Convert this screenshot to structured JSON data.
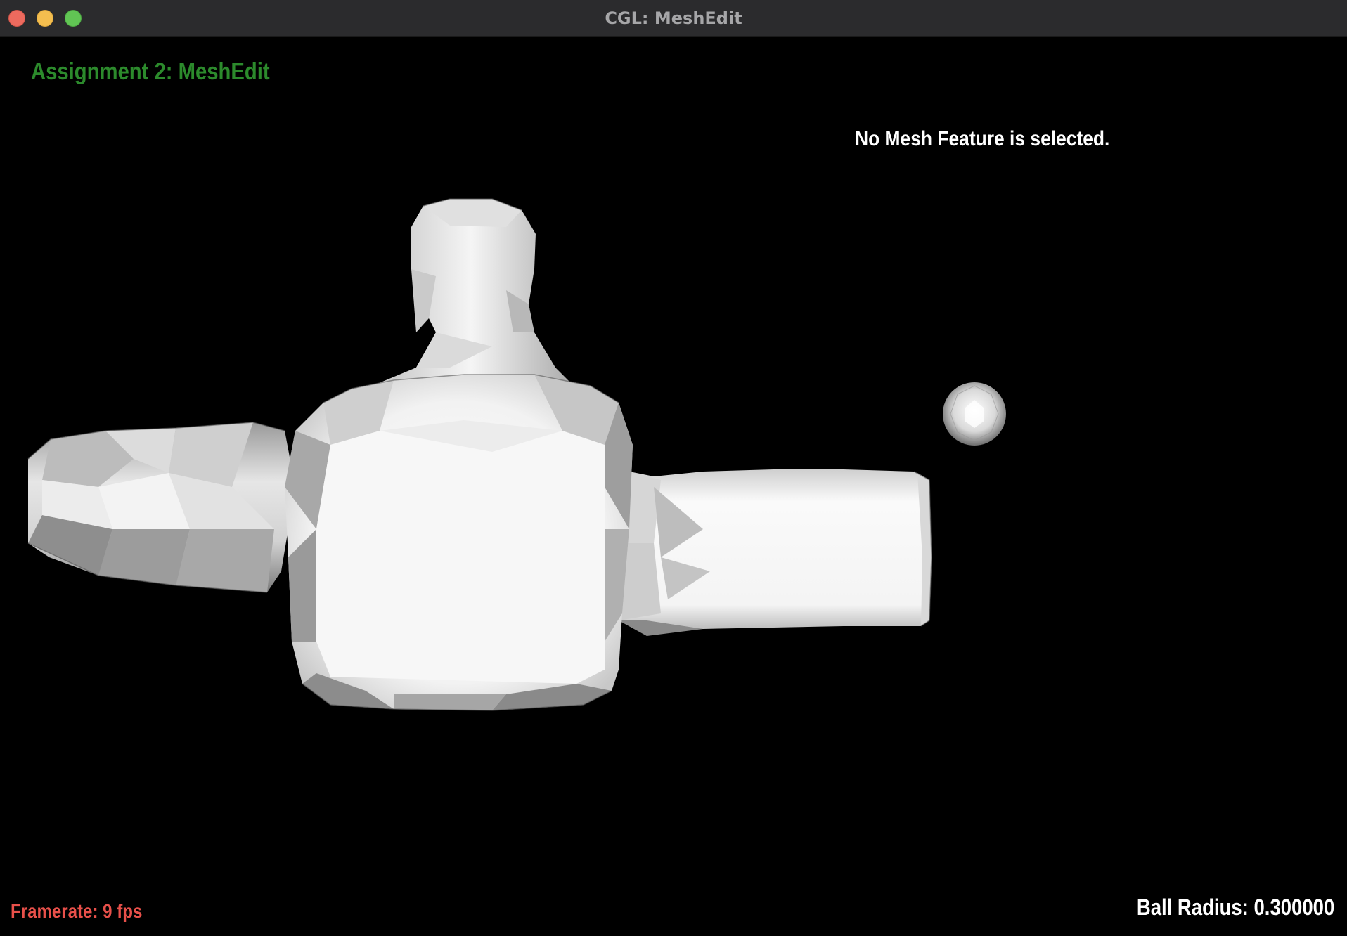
{
  "window": {
    "title": "CGL: MeshEdit"
  },
  "hud": {
    "assignment_title": "Assignment 2: MeshEdit",
    "selection_status": "No Mesh Feature is selected.",
    "framerate": "Framerate: 9 fps",
    "ball_radius": "Ball Radius: 0.300000"
  },
  "colors": {
    "title_green": "#2c8a2c",
    "framerate_red": "#e8504a",
    "background": "#000000",
    "mesh": "#f2f2f2"
  },
  "icons": [
    "close-window-icon",
    "minimize-window-icon",
    "maximize-window-icon"
  ]
}
